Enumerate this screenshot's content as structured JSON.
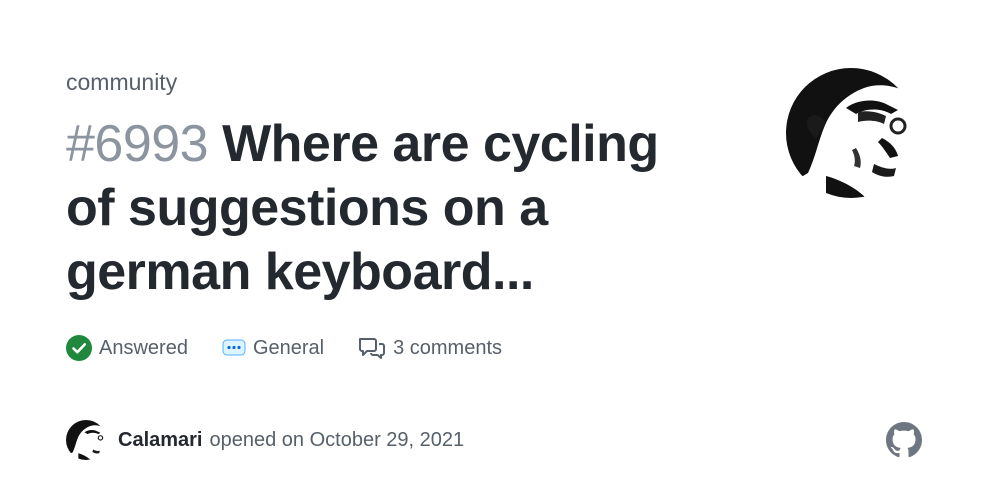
{
  "repo": {
    "label": "community"
  },
  "discussion": {
    "number": "#6993",
    "title": "Where are cycling of suggestions on a german keyboard..."
  },
  "meta": {
    "status": "Answered",
    "category": "General",
    "comments": "3 comments"
  },
  "author": {
    "name": "Calamari",
    "opened_text": "opened on October 29, 2021"
  },
  "colors": {
    "answered_green": "#1f883d",
    "title_text": "#24292f",
    "muted_text": "#57606a",
    "number_gray": "#8c959f",
    "github_mark": "#6e7781"
  },
  "icons": {
    "status": "check-circle-icon",
    "category": "speech-bubble-dots-icon",
    "comments": "comment-discussion-icon",
    "brand": "github-mark-icon"
  }
}
